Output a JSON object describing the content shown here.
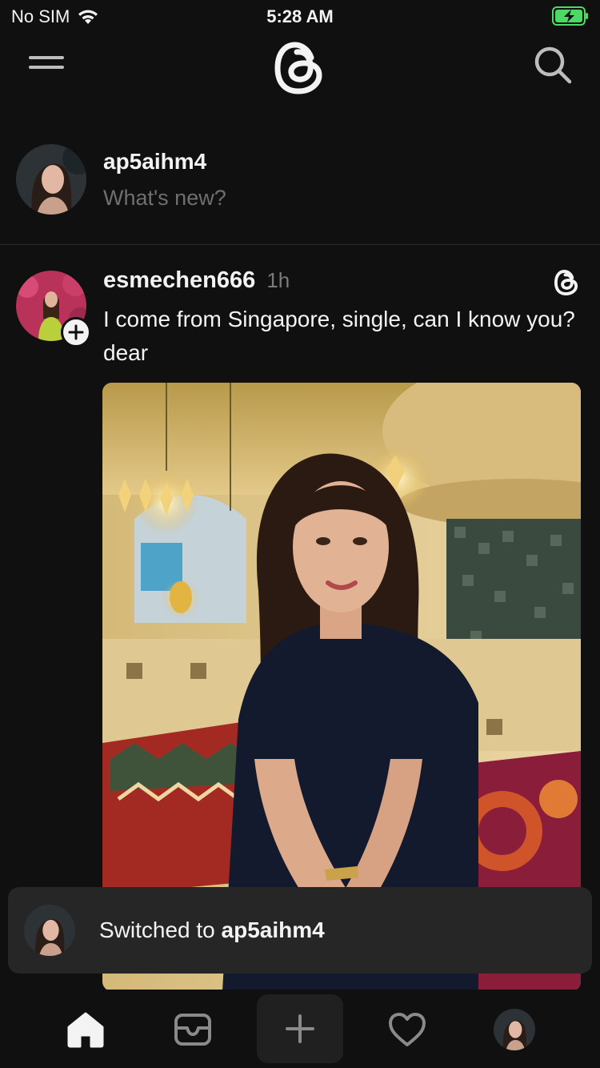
{
  "status_bar": {
    "carrier": "No SIM",
    "time": "5:28 AM"
  },
  "header": {
    "menu_icon": "menu-icon",
    "logo_icon": "threads-logo-icon",
    "search_icon": "search-icon"
  },
  "composer": {
    "username": "ap5aihm4",
    "prompt": "What's new?"
  },
  "post": {
    "author": "esmechen666",
    "time": "1h",
    "text": "I come from Singapore, single, can I know you? dear"
  },
  "toast": {
    "prefix": "Switched to ",
    "username": "ap5aihm4"
  },
  "nav": [
    "home-icon",
    "inbox-icon",
    "create-icon",
    "activity-heart-icon",
    "profile-avatar"
  ],
  "colors": {
    "background": "#101010",
    "text": "#f3f3f3",
    "muted": "#6f6f6f",
    "toast": "#262626",
    "battery": "#4cd964"
  }
}
